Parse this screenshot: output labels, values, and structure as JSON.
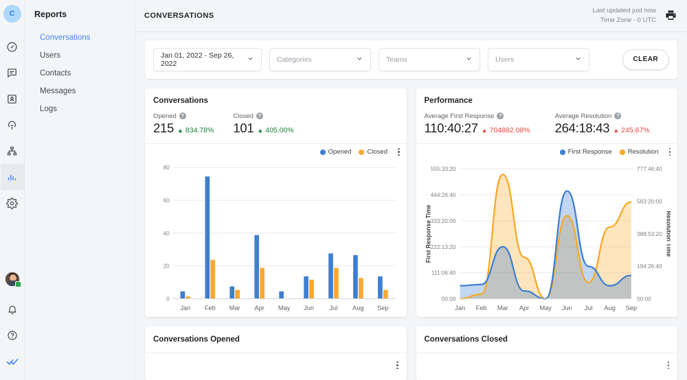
{
  "brand": {
    "logo_letter": "C"
  },
  "rail": {
    "items": [
      {
        "name": "dashboard-icon",
        "label": "Dashboard"
      },
      {
        "name": "conversations-icon",
        "label": "Conversations"
      },
      {
        "name": "contacts-icon",
        "label": "Contacts"
      },
      {
        "name": "campaigns-icon",
        "label": "Campaigns"
      },
      {
        "name": "automations-icon",
        "label": "Automations"
      },
      {
        "name": "reports-icon",
        "label": "Reports"
      },
      {
        "name": "settings-icon",
        "label": "Settings"
      }
    ],
    "bottom": [
      {
        "name": "user-avatar",
        "label": "Account"
      },
      {
        "name": "bell-icon",
        "label": "Notifications"
      },
      {
        "name": "help-icon",
        "label": "Help"
      },
      {
        "name": "double-check-icon",
        "label": "Read receipts"
      }
    ]
  },
  "sidebar": {
    "title": "Reports",
    "items": [
      {
        "label": "Conversations",
        "active": true
      },
      {
        "label": "Users",
        "active": false
      },
      {
        "label": "Contacts",
        "active": false
      },
      {
        "label": "Messages",
        "active": false
      },
      {
        "label": "Logs",
        "active": false
      }
    ]
  },
  "header": {
    "title": "CONVERSATIONS",
    "last_updated": "Last updated just now",
    "timezone": "Time Zone - 0 UTC",
    "print_icon": "printer-icon"
  },
  "filters": {
    "date_range": {
      "value": "Jan 01, 2022 - Sep 26, 2022"
    },
    "categories": {
      "placeholder": "Categories",
      "value": ""
    },
    "teams": {
      "placeholder": "Teams",
      "value": ""
    },
    "users": {
      "placeholder": "Users",
      "value": ""
    },
    "clear_label": "CLEAR"
  },
  "conversations_card": {
    "title": "Conversations",
    "kpis": [
      {
        "label": "Opened",
        "value": "215",
        "delta": "834.78%",
        "direction": "up"
      },
      {
        "label": "Closed",
        "value": "101",
        "delta": "405.00%",
        "direction": "up"
      }
    ]
  },
  "performance_card": {
    "title": "Performance",
    "kpis": [
      {
        "label": "Average First Response",
        "value": "110:40:27",
        "delta": "704882.08%",
        "direction": "down"
      },
      {
        "label": "Average Resolution",
        "value": "264:18:43",
        "delta": "245.67%",
        "direction": "down"
      }
    ]
  },
  "bottom_cards": [
    {
      "title": "Conversations Opened"
    },
    {
      "title": "Conversations Closed"
    }
  ],
  "colors": {
    "opened_blue": "#3f7fd0",
    "closed_orange": "#faa831",
    "first_response_blue": "#3f7fd0",
    "resolution_orange": "#f9a825",
    "positive_green": "#188038",
    "negative_red": "#e8453c",
    "accent": "#4285f4"
  },
  "chart_data": [
    {
      "type": "bar",
      "title": "Conversations",
      "categories": [
        "Jan",
        "Feb",
        "Mar",
        "Apr",
        "May",
        "Jun",
        "Jul",
        "Aug",
        "Sep"
      ],
      "series": [
        {
          "name": "Opened",
          "color": "#3f7fd0",
          "values": [
            4.5,
            74.5,
            7.5,
            38.8,
            4.5,
            13.6,
            27.6,
            26.6,
            13.6
          ]
        },
        {
          "name": "Closed",
          "color": "#faa831",
          "values": [
            1.4,
            23.7,
            5.4,
            18.8,
            0,
            11.6,
            18.8,
            12.6,
            5.4
          ]
        }
      ],
      "ylabel": "",
      "xlabel": "",
      "ylim": [
        0,
        80
      ],
      "yticks": [
        0,
        20,
        40,
        60,
        80
      ],
      "legend": [
        "Opened",
        "Closed"
      ],
      "legend_position": "top-right",
      "grid": true
    },
    {
      "type": "area",
      "title": "Performance",
      "x": [
        "Jan",
        "Feb",
        "Mar",
        "Apr",
        "May",
        "Jun",
        "Jul",
        "Aug",
        "Sep"
      ],
      "series": [
        {
          "name": "First Response",
          "color": "#3f7fd0",
          "axis": "left",
          "values": [
            55.5,
            61.0,
            222.2,
            33.3,
            0.0,
            461.0,
            138.8,
            55.5,
            100.0
          ]
        },
        {
          "name": "Resolution",
          "color": "#f9a825",
          "axis": "right",
          "values": [
            0.0,
            27.0,
            744.0,
            248.0,
            0.0,
            497.0,
            97.0,
            430.0,
            580.0
          ]
        }
      ],
      "left_axis_label": "First Response Time",
      "right_axis_label": "Resolution Time",
      "left_yticks": [
        "00:00",
        "111:06:40",
        "222:13:20",
        "333:20:00",
        "444:26:40",
        "555:33:20"
      ],
      "right_yticks": [
        "00:00",
        "194:26:40",
        "388:53:20",
        "583:20:00",
        "777:46:40"
      ],
      "left_ylim": [
        0,
        555.5555
      ],
      "right_ylim": [
        0,
        777.7777
      ],
      "legend": [
        "First Response",
        "Resolution"
      ],
      "legend_position": "top-right",
      "grid": true
    }
  ]
}
